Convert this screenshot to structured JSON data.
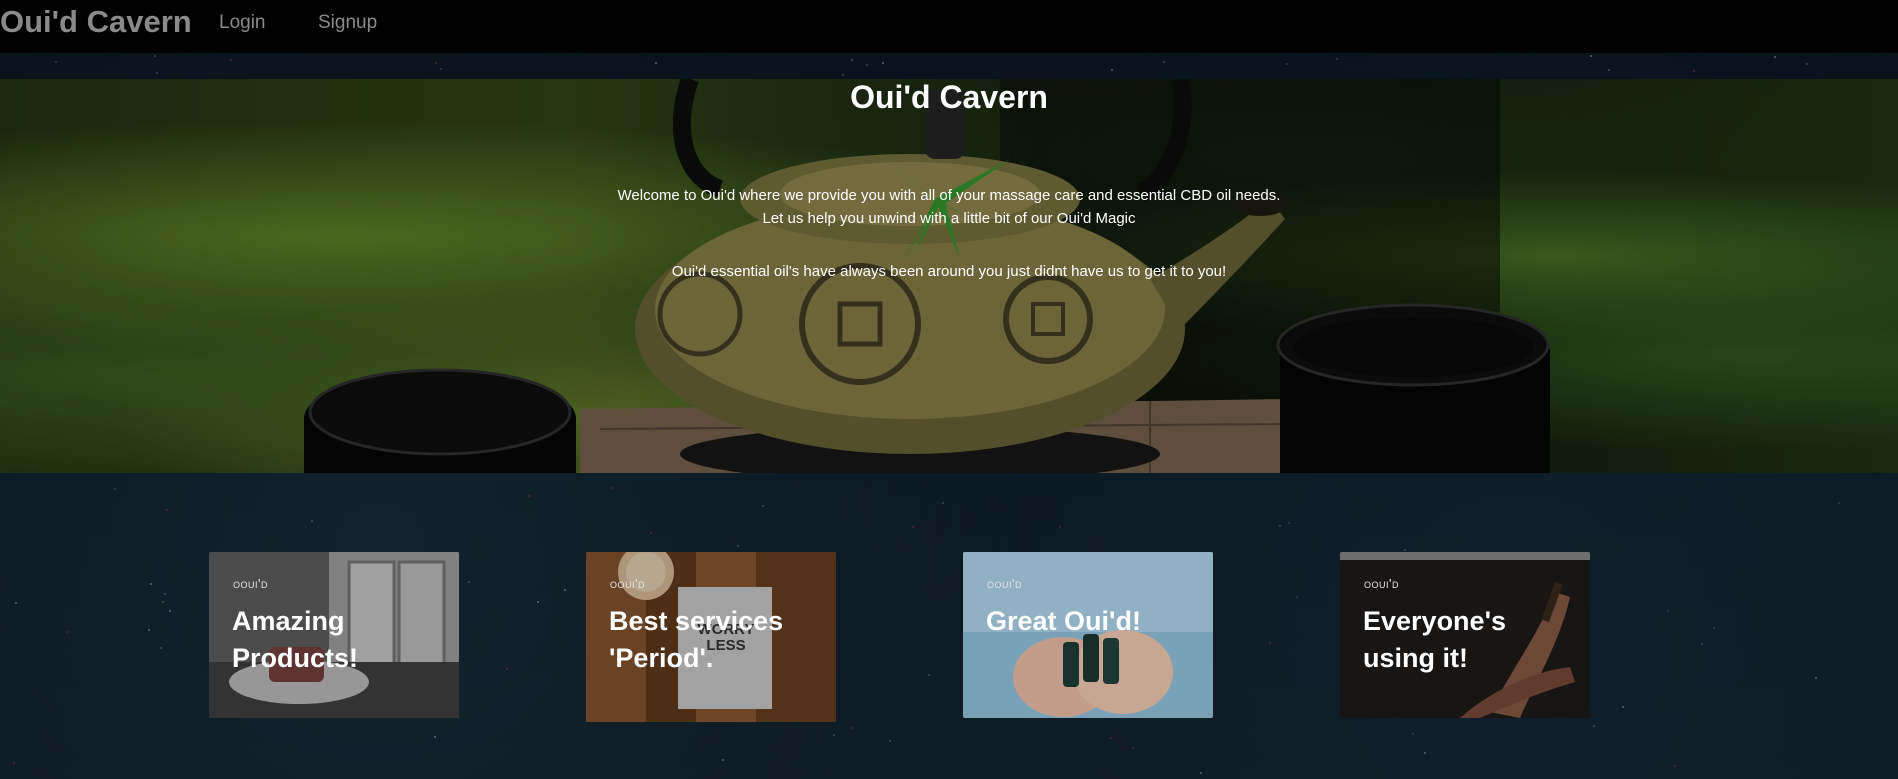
{
  "navbar": {
    "brand": "Oui'd Cavern",
    "links": [
      {
        "label": "Login"
      },
      {
        "label": "Signup"
      }
    ]
  },
  "hero": {
    "title": "Oui'd Cavern",
    "line1": "Welcome to Oui'd where we provide you with all of your massage care and essential CBD oil needs.",
    "line2": "Let us help you unwind with a little bit of our Oui'd Magic",
    "line3": "Oui'd essential oil's have always been around you just didnt have us to get it to you!"
  },
  "cards": [
    {
      "brand": "ooui'd",
      "title": "Amazing Products!"
    },
    {
      "brand": "ooui'd",
      "title": "Best services 'Period'.",
      "sign_text": "WORRY LESS"
    },
    {
      "brand": "ooui'd",
      "title": "Great Oui'd!"
    },
    {
      "brand": "ooui'd",
      "title": "Everyone's using it!"
    }
  ],
  "colors": {
    "navbar_bg": "#000000",
    "nav_text": "#8a8a8a",
    "page_bg": "#0a141b",
    "hero_text": "#ffffff"
  }
}
